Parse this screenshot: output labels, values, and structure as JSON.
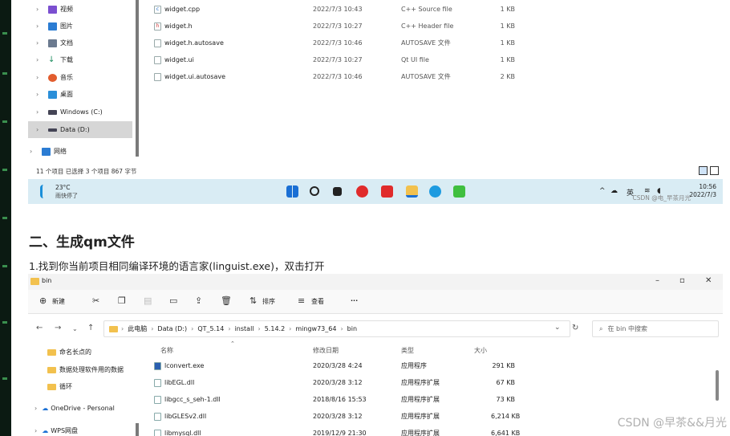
{
  "top_explorer": {
    "sidebar": [
      {
        "label": "视频",
        "icon": "video-icon",
        "color": "#7b4fd0"
      },
      {
        "label": "图片",
        "icon": "picture-icon",
        "color": "#2b7cd3"
      },
      {
        "label": "文档",
        "icon": "document-icon",
        "color": "#6b7a8f"
      },
      {
        "label": "下载",
        "icon": "download-icon",
        "color": "#1c8c5e"
      },
      {
        "label": "音乐",
        "icon": "music-icon",
        "color": "#e25d2e"
      },
      {
        "label": "桌面",
        "icon": "desktop-icon",
        "color": "#2b8fd9"
      },
      {
        "label": "Windows (C:)",
        "icon": "drive-icon",
        "color": "#445"
      },
      {
        "label": "Data (D:)",
        "icon": "drive-icon",
        "color": "#445",
        "selected": true
      },
      {
        "label": "网络",
        "icon": "network-icon",
        "color": "#2b7cd3"
      }
    ],
    "files": [
      {
        "name": "widget.cpp",
        "date": "2022/7/3 10:43",
        "type": "C++ Source file",
        "size": "1 KB",
        "icon": "cpp-file-icon"
      },
      {
        "name": "widget.h",
        "date": "2022/7/3 10:27",
        "type": "C++ Header file",
        "size": "1 KB",
        "icon": "header-file-icon"
      },
      {
        "name": "widget.h.autosave",
        "date": "2022/7/3 10:46",
        "type": "AUTOSAVE 文件",
        "size": "1 KB",
        "icon": "file-icon"
      },
      {
        "name": "widget.ui",
        "date": "2022/7/3 10:27",
        "type": "Qt UI file",
        "size": "1 KB",
        "icon": "ui-file-icon"
      },
      {
        "name": "widget.ui.autosave",
        "date": "2022/7/3 10:46",
        "type": "AUTOSAVE 文件",
        "size": "2 KB",
        "icon": "file-icon"
      }
    ],
    "status": "11 个项目    已选择 3 个项目  867 字节"
  },
  "taskbar": {
    "temp": "23°C",
    "weather": "雨快停了",
    "tray_lang": "英",
    "time": "10:56",
    "date": "2022/7/3",
    "watermark": "CSDN @电_早茶月光"
  },
  "article": {
    "heading": "二、生成qm文件",
    "paragraph": "1.找到你当前项目相同编译环境的语言家(linguist.exe)，双击打开"
  },
  "bottom_explorer": {
    "title": "bin",
    "toolbar": {
      "new": "新建",
      "sort": "排序",
      "view": "查看",
      "more": "···"
    },
    "breadcrumb": [
      "此电脑",
      "Data (D:)",
      "QT_5.14",
      "install",
      "5.14.2",
      "mingw73_64",
      "bin"
    ],
    "search_placeholder": "在 bin 中搜索",
    "sidebar": [
      {
        "label": "命名长点的"
      },
      {
        "label": "数据处理软件用的数据"
      },
      {
        "label": "循环"
      },
      {
        "label": "OneDrive - Personal"
      },
      {
        "label": "WPS网盘"
      }
    ],
    "columns": {
      "name": "名称",
      "date": "修改日期",
      "type": "类型",
      "size": "大小"
    },
    "files": [
      {
        "name": "lconvert.exe",
        "date": "2020/3/28 4:24",
        "type": "应用程序",
        "size": "291 KB"
      },
      {
        "name": "libEGL.dll",
        "date": "2020/3/28 3:12",
        "type": "应用程序扩展",
        "size": "67 KB"
      },
      {
        "name": "libgcc_s_seh-1.dll",
        "date": "2018/8/16 15:53",
        "type": "应用程序扩展",
        "size": "73 KB"
      },
      {
        "name": "libGLESv2.dll",
        "date": "2020/3/28 3:12",
        "type": "应用程序扩展",
        "size": "6,214 KB"
      },
      {
        "name": "libmysql.dll",
        "date": "2019/12/9 21:30",
        "type": "应用程序扩展",
        "size": "6,641 KB"
      }
    ]
  },
  "watermark": "CSDN @早茶&&月光"
}
